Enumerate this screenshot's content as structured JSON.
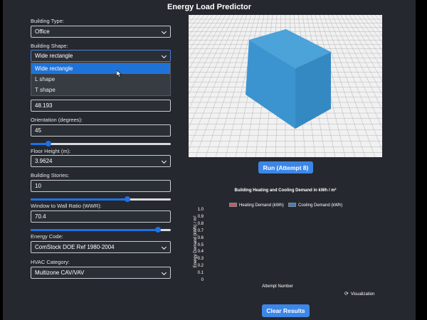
{
  "app": {
    "title": "Energy Load Predictor"
  },
  "form": {
    "building_type": {
      "label": "Building Type:",
      "value": "Office"
    },
    "building_shape": {
      "label": "Building Shape:",
      "value": "Wide rectangle",
      "options": [
        "Wide rectangle",
        "L shape",
        "T shape"
      ]
    },
    "width": {
      "value": "48.193"
    },
    "orientation": {
      "label": "Orientation (degrees):",
      "value": "45",
      "slider_fraction": 0.125
    },
    "floor_height": {
      "label": "Floor Height (m):",
      "value": "3.9624"
    },
    "stories": {
      "label": "Building Stories:",
      "value": "10",
      "slider_fraction": 0.69
    },
    "wwr": {
      "label": "Window to Wall Ratio (WWR):",
      "value": "70.4",
      "slider_fraction": 0.91
    },
    "energy_code": {
      "label": "Energy Code:",
      "value": "ComStock DOE Ref 1980-2004"
    },
    "hvac": {
      "label": "HVAC Category:",
      "value": "Multizone CAV/VAV"
    }
  },
  "actions": {
    "run_label": "Run (Attempt 8)",
    "clear_label": "Clear Results"
  },
  "colors": {
    "accent": "#3d86e8",
    "cube": "#3f9ad4",
    "heating": "#c8566b",
    "cooling": "#3c7fc2"
  },
  "chart_data": {
    "type": "bar",
    "title": "Building Heating and Cooling Demand in kWh / m²",
    "xlabel": "Attempt Number",
    "ylabel": "Energy Demand (kWh) / m²",
    "ylim": [
      0,
      1.0
    ],
    "yticks": [
      "1.0",
      "0.9",
      "0.8",
      "0.7",
      "0.6",
      "0.5",
      "0.4",
      "0.3",
      "0.2",
      "0.1",
      "0"
    ],
    "categories": [],
    "series": [
      {
        "name": "Heating Demand (kWh)",
        "values": []
      },
      {
        "name": "Cooling Demand (kWh)",
        "values": []
      }
    ],
    "legend": "top"
  },
  "visualization_toggle": {
    "label": "Visualization",
    "icon": "refresh-icon"
  }
}
